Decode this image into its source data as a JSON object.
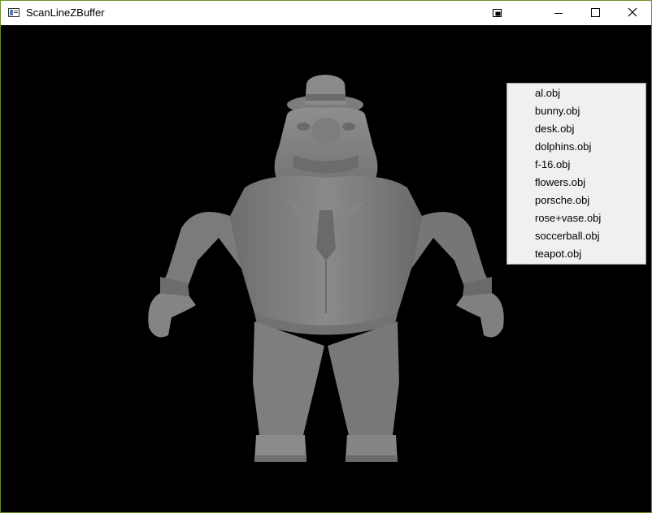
{
  "window": {
    "title": "ScanLineZBuffer"
  },
  "titlebar": {
    "buttons": [
      {
        "name": "restore-layout-icon"
      },
      {
        "name": "minimize-icon"
      },
      {
        "name": "maximize-icon"
      },
      {
        "name": "close-icon"
      }
    ]
  },
  "viewport": {
    "background": "#000000",
    "model_color": "#7a7a7a",
    "model_icon": "rendered-3d-character-model"
  },
  "context_menu": {
    "items": [
      "al.obj",
      "bunny.obj",
      "desk.obj",
      "dolphins.obj",
      "f-16.obj",
      "flowers.obj",
      "porsche.obj",
      "rose+vase.obj",
      "soccerball.obj",
      "teapot.obj"
    ]
  }
}
